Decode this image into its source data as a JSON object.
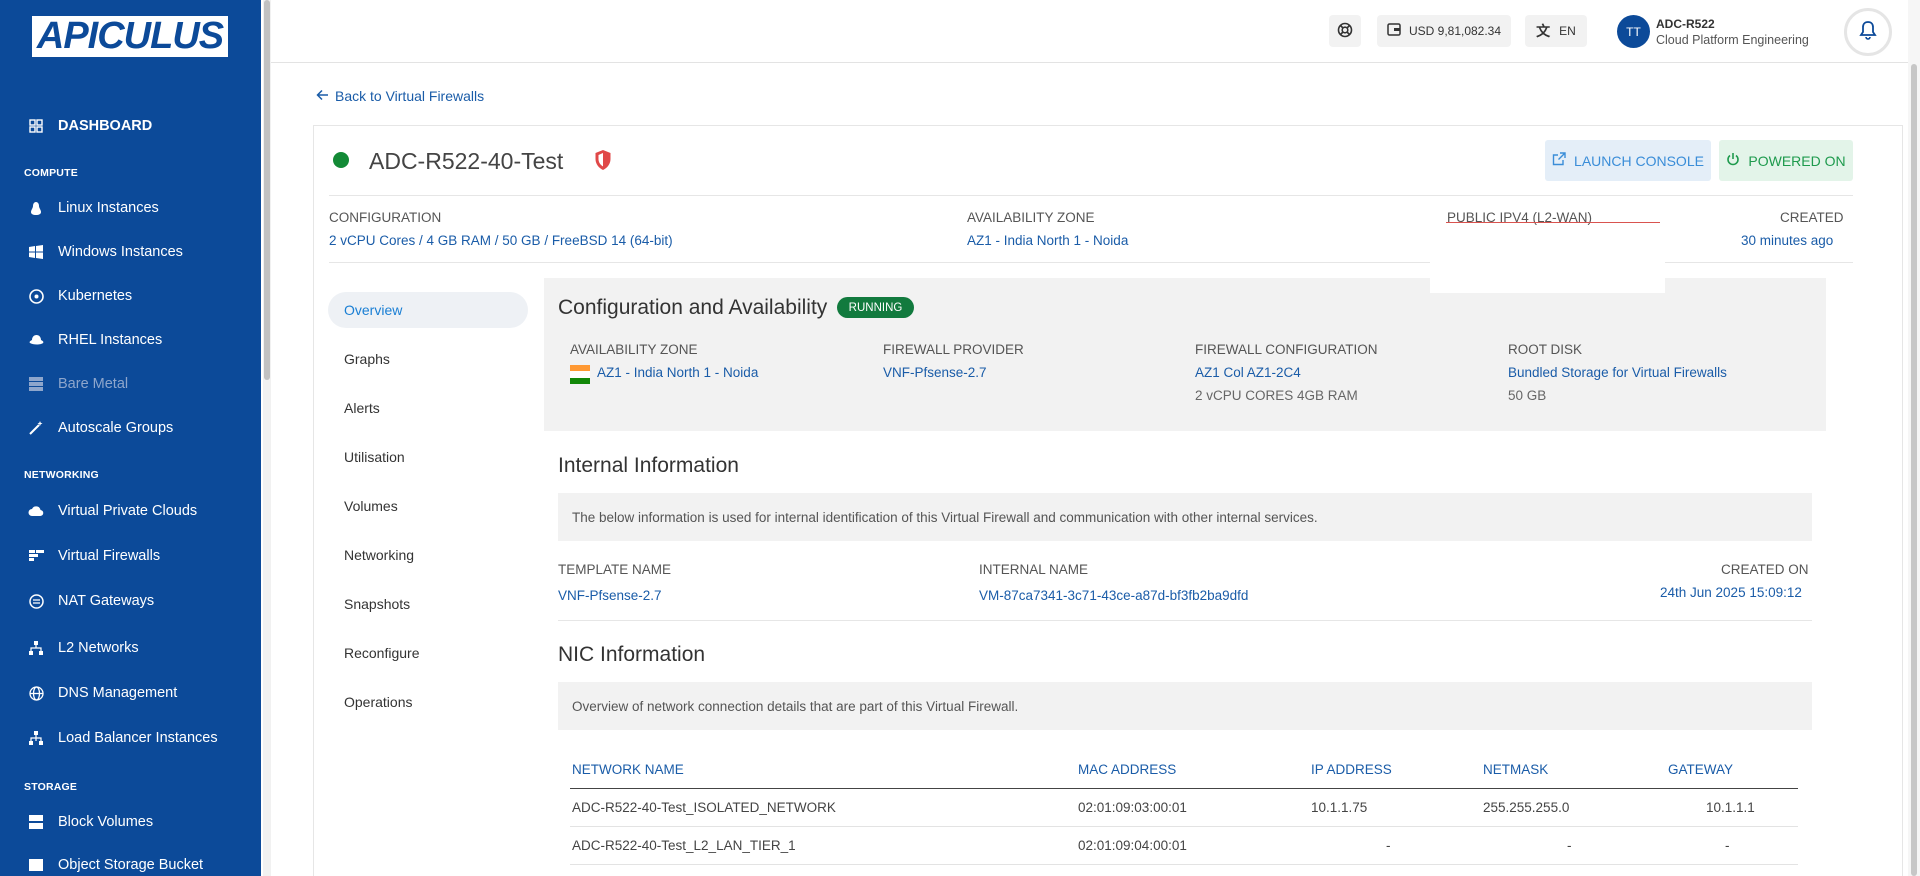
{
  "sidebar": {
    "logo": "APICULUS",
    "dashboard": "DASHBOARD",
    "sections": {
      "compute": "COMPUTE",
      "networking": "NETWORKING",
      "storage": "STORAGE"
    },
    "compute_items": [
      "Linux Instances",
      "Windows Instances",
      "Kubernetes",
      "RHEL Instances",
      "Bare Metal",
      "Autoscale Groups"
    ],
    "networking_items": [
      "Virtual Private Clouds",
      "Virtual Firewalls",
      "NAT Gateways",
      "L2 Networks",
      "DNS Management",
      "Load Balancer Instances"
    ],
    "storage_items": [
      "Block Volumes",
      "Object Storage Bucket"
    ]
  },
  "header": {
    "balance": "USD 9,81,082.34",
    "language": "EN",
    "avatar_initials": "TT",
    "user_name": "ADC-R522",
    "user_org": "Cloud Platform Engineering"
  },
  "back_link": "Back to Virtual Firewalls",
  "vm": {
    "name": "ADC-R522-40-Test",
    "launch_console": "LAUNCH CONSOLE",
    "powered_on": "POWERED ON"
  },
  "summary": {
    "configuration_label": "CONFIGURATION",
    "configuration_value": "2 vCPU Cores / 4 GB RAM / 50 GB / FreeBSD 14 (64-bit)",
    "az_label": "AVAILABILITY ZONE",
    "az_value": "AZ1 - India North 1 - Noida",
    "ip_label": "PUBLIC IPV4 (L2-WAN)",
    "created_label": "CREATED",
    "created_value": "30 minutes ago"
  },
  "tabs": [
    "Overview",
    "Graphs",
    "Alerts",
    "Utilisation",
    "Volumes",
    "Networking",
    "Snapshots",
    "Reconfigure",
    "Operations"
  ],
  "config_availability": {
    "title": "Configuration and Availability",
    "status": "RUNNING",
    "az_label": "AVAILABILITY ZONE",
    "az_value": "AZ1 - India North 1 - Noida",
    "provider_label": "FIREWALL PROVIDER",
    "provider_value": "VNF-Pfsense-2.7",
    "fw_config_label": "FIREWALL CONFIGURATION",
    "fw_config_value": "AZ1 Col AZ1-2C4",
    "fw_config_detail": "2 vCPU CORES 4GB RAM",
    "root_disk_label": "ROOT DISK",
    "root_disk_value": "Bundled Storage for Virtual Firewalls",
    "root_disk_size": "50 GB"
  },
  "internal": {
    "title": "Internal Information",
    "description": "The below information is used for internal identification of this Virtual Firewall and communication with other internal services.",
    "template_label": "TEMPLATE NAME",
    "template_value": "VNF-Pfsense-2.7",
    "internal_name_label": "INTERNAL NAME",
    "internal_name_value": "VM-87ca7341-3c71-43ce-a87d-bf3fb2ba9dfd",
    "created_on_label": "CREATED ON",
    "created_on_value": "24th Jun 2025 15:09:12"
  },
  "nic": {
    "title": "NIC Information",
    "description": "Overview of network connection details that are part of this Virtual Firewall.",
    "headers": [
      "NETWORK NAME",
      "MAC ADDRESS",
      "IP ADDRESS",
      "NETMASK",
      "GATEWAY"
    ],
    "rows": [
      [
        "ADC-R522-40-Test_ISOLATED_NETWORK",
        "02:01:09:03:00:01",
        "10.1.1.75",
        "255.255.255.0",
        "10.1.1.1"
      ],
      [
        "ADC-R522-40-Test_L2_LAN_TIER_1",
        "02:01:09:04:00:01",
        "-",
        "-",
        "-"
      ]
    ]
  },
  "colors": {
    "sidebar": "#0c4a99",
    "link": "#1a5ca8",
    "running": "#127a3e",
    "status_dot": "#138a36"
  }
}
